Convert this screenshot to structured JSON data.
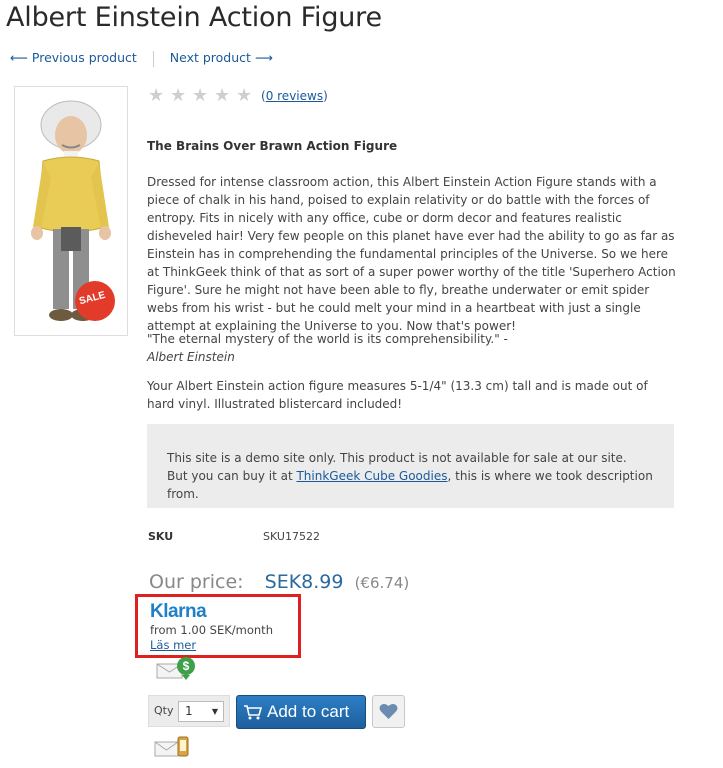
{
  "product": {
    "title": "Albert Einstein Action Figure",
    "sale_badge": "SALE"
  },
  "nav": {
    "prev_label": "⟵ Previous product",
    "next_label": "Next product ⟶"
  },
  "rating": {
    "stars": 0,
    "max_stars": 5,
    "reviews_label": "0 reviews",
    "paren_open": "(",
    "paren_close": ")"
  },
  "description": {
    "subtitle": "The Brains Over Brawn Action Figure",
    "body": "Dressed for intense classroom action, this Albert Einstein Action Figure stands with a piece of chalk in his hand, poised to explain relativity or do battle with the forces of entropy. Fits in nicely with any office, cube or dorm decor and features realistic disheveled hair! Very few people on this planet have ever had the ability to go as far as Einstein has in comprehending the fundamental principles of the Universe. So we here at ThinkGeek think of that as sort of a super power worthy of the title 'Superhero Action Figure'. Sure he might not have been able to fly, breathe underwater or emit spider webs from his wrist - but he could melt your mind in a heartbeat with just a single attempt at explaining the Universe to you. Now that's power!",
    "quote": "\"The eternal mystery of the world is its comprehensibility.\" -",
    "quote_author": "Albert Einstein",
    "spec": "Your Albert Einstein action figure measures 5-1/4\" (13.3 cm) tall and is made out of hard vinyl. Illustrated blistercard included!"
  },
  "demo_notice": {
    "line1": "This site is a demo site only. This product is not available for sale at our site.",
    "line2_before": "But you can buy it at ",
    "link": "ThinkGeek Cube Goodies",
    "line2_after": ", this is where we took description from."
  },
  "sku": {
    "label": "SKU",
    "value": "SKU17522"
  },
  "price": {
    "label": "Our price:",
    "value": "SEK8.99",
    "alt": "(€6.74)"
  },
  "klarna": {
    "logo": "Klarna",
    "from_text": "from 1.00 SEK/month",
    "link": "Läs mer",
    "highlight_color": "#e02020"
  },
  "cart": {
    "qty_label": "Qty",
    "qty_value": "1",
    "add_label": "Add to cart"
  },
  "colors": {
    "accent": "#1a5a9a",
    "button": "#2a6fb0"
  }
}
